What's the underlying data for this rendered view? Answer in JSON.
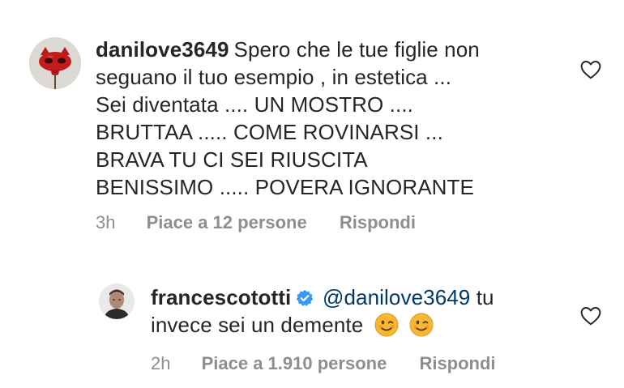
{
  "comments": [
    {
      "username": "danilove3649",
      "text": "Spero che le tue figlie non seguano il tuo esempio , in estetica ... Sei diventata .... UN MOSTRO .... BRUTTAA ..... COME ROVINARSI ... BRAVA TU CI SEI RIUSCITA BENISSIMO ..... POVERA IGNORANTE",
      "lines": [
        "Spero che le tue figlie non",
        "seguano il tuo esempio , in estetica ...",
        "Sei diventata .... UN MOSTRO ....",
        "BRUTTAA ..... COME ROVINARSI ...",
        "BRAVA TU CI SEI RIUSCITA",
        "BENISSIMO ..... POVERA IGNORANTE"
      ],
      "time": "3h",
      "likes": "Piace a 12 persone",
      "reply": "Rispondi"
    },
    {
      "username": "francescototti",
      "verified": true,
      "mention": "@danilove3649",
      "line1_rest": "tu",
      "line2": "invece sei un demente",
      "time": "2h",
      "likes": "Piace a 1.910 persone",
      "reply": "Rispondi"
    }
  ],
  "icons": {
    "like": "heart-outline-icon",
    "verified": "verified-badge-icon",
    "emoji": "winking-face-emoji"
  },
  "colors": {
    "text": "#262626",
    "meta": "#8e8e8e",
    "mention": "#00376b",
    "verified": "#3897f0"
  }
}
